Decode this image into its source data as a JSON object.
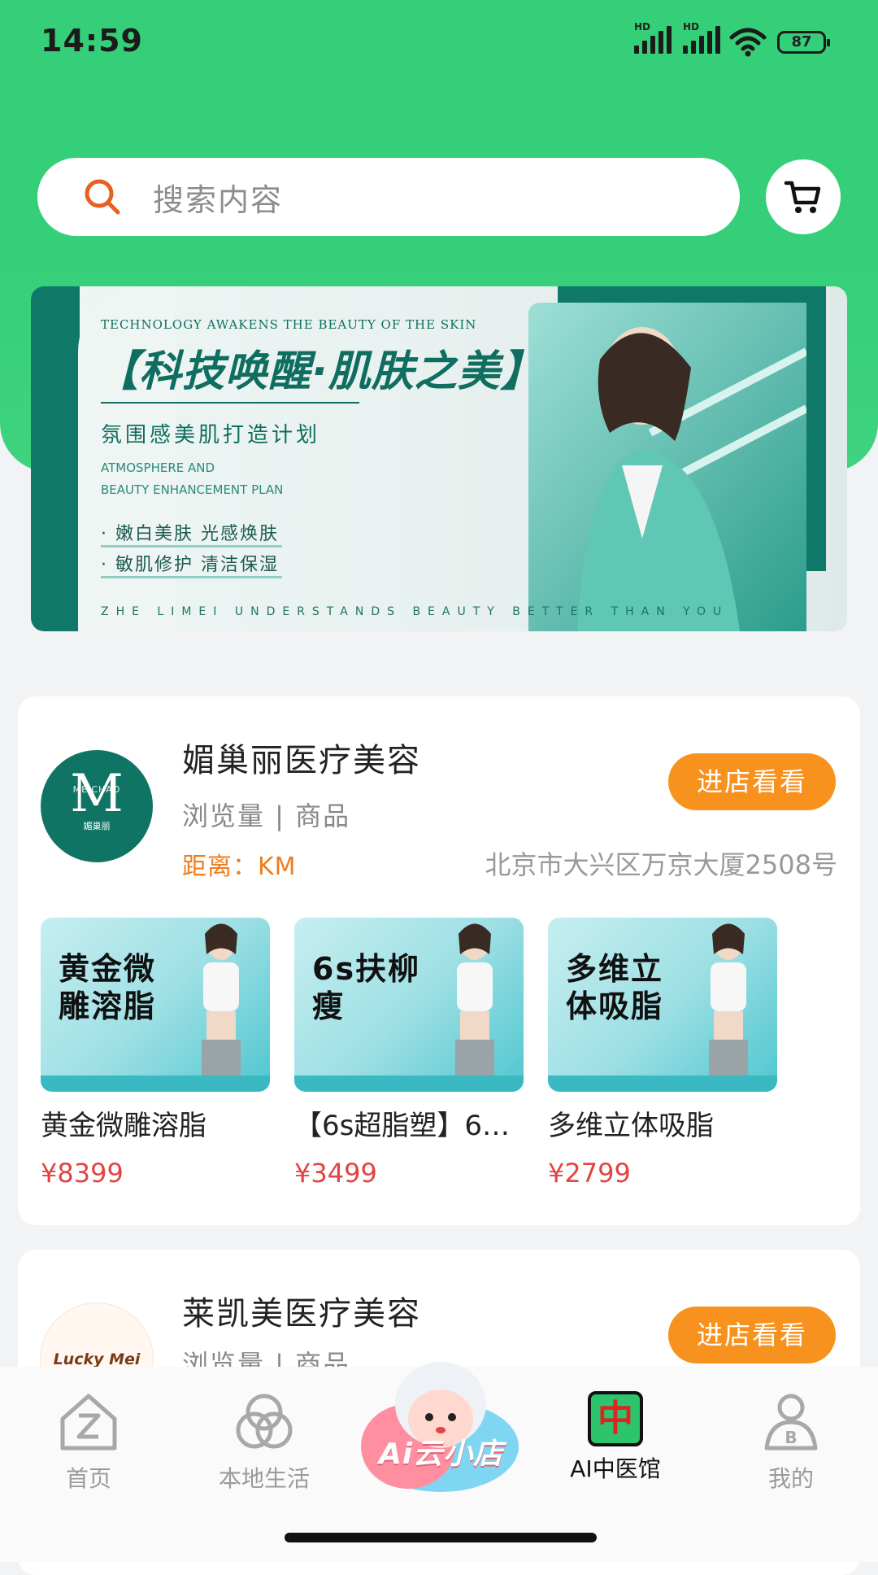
{
  "status": {
    "time": "14:59",
    "battery": "87",
    "hd1": "HD",
    "hd2": "HD"
  },
  "search": {
    "placeholder": "搜索内容"
  },
  "banner": {
    "en_top": "TECHNOLOGY AWAKENS THE BEAUTY OF THE SKIN",
    "title": "【科技唤醒·肌肤之美】",
    "subtitle": "氛围感美肌打造计划",
    "en_mid_1": "ATMOSPHERE AND",
    "en_mid_2": "BEAUTY ENHANCEMENT PLAN",
    "bullet1": "· 嫩白美肤 光感焕肤",
    "bullet2": "· 敏肌修护 清洁保湿",
    "footer": "ZHE LIMEI UNDERSTANDS BEAUTY BETTER THAN YOU"
  },
  "shops": [
    {
      "name": "媚巢丽医疗美容",
      "meta": "浏览量 | 商品",
      "distance": "距离：KM",
      "address": "北京市大兴区万京大厦2508号",
      "enter_label": "进店看看",
      "logo_letter": "M",
      "logo_text": "MEICHAO",
      "logo_cn": "媚巢丽",
      "products": [
        {
          "image_label": "黄金微雕溶脂",
          "name": "黄金微雕溶脂",
          "price": "¥8399"
        },
        {
          "image_label": "6s扶柳瘦",
          "name": "【6s超脂塑】6s…",
          "price": "¥3499"
        },
        {
          "image_label": "多维立体吸脂",
          "name": "多维立体吸脂",
          "price": "¥2799"
        }
      ]
    },
    {
      "name": "莱凯美医疗美容",
      "meta": "浏览量 | 商品",
      "enter_label": "进店看看",
      "logo_text": "Lucky Mei"
    }
  ],
  "tabs": [
    {
      "label": "首页",
      "icon": "home-icon"
    },
    {
      "label": "本地生活",
      "icon": "local-life-icon"
    },
    {
      "label": "Ai云小店",
      "icon": "ai-mascot-icon"
    },
    {
      "label": "AI中医馆",
      "icon": "tcm-icon",
      "icon_char": "中"
    },
    {
      "label": "我的",
      "icon": "profile-icon"
    }
  ],
  "colors": {
    "brand_green": "#36cf79",
    "accent_orange": "#f7921e",
    "price_red": "#e24444"
  }
}
